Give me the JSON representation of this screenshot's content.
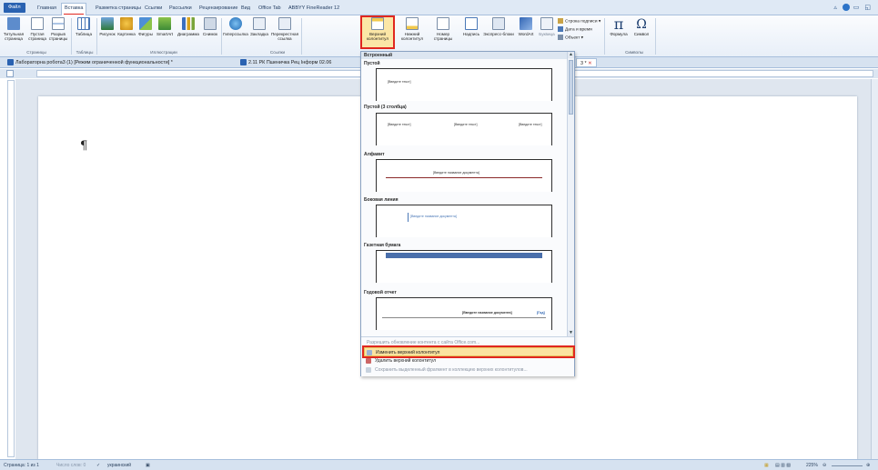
{
  "tabs": [
    "Файл",
    "Главная",
    "Вставка",
    "Разметка страницы",
    "Ссылки",
    "Рассылки",
    "Рецензирование",
    "Вид",
    "Office Tab",
    "ABBYY FineReader 12"
  ],
  "ribbon": {
    "buttons": {
      "title_page": "Титульная страница",
      "blank_page": "Пустая страница",
      "page_break": "Разрыв страницы",
      "table": "Таблица",
      "picture": "Рисунок",
      "clipart": "Картинка",
      "shapes": "Фигуры",
      "smartart": "SmartArt",
      "chart": "Диаграмма",
      "screenshot": "Снимок",
      "hyperlink": "Гиперссылка",
      "bookmark": "Закладка",
      "crossref": "Перекрестная ссылка",
      "header": "Верхний колонтитул",
      "footer": "Нижний колонтитул",
      "page_number": "Номер страницы",
      "textbox": "Надпись",
      "quickparts": "Экспресс-блоки",
      "wordart": "WordArt",
      "dropcap": "Буквица",
      "formula": "Формула",
      "symbol": "Символ"
    },
    "small": {
      "signature": "Строка подписи",
      "datetime": "Дата и время",
      "object": "Объект"
    },
    "groups": {
      "pages": "Страницы",
      "tables": "Таблицы",
      "illustrations": "Иллюстрации",
      "links": "Ссылки",
      "symbols": "Символы"
    }
  },
  "doc_tabs": {
    "doc1": "Лабораторна робота3 (1) [Режим ограниченной функциональности] *",
    "doc2": "2.11 РК Пшеничка Рец Інформ 02.06",
    "doc3": "3 *"
  },
  "dropdown": {
    "header": "Встроенный",
    "items": [
      {
        "title": "Пустой",
        "placeholders": [
          "[Введите текст]"
        ]
      },
      {
        "title": "Пустой (3 столбца)",
        "placeholders": [
          "[Введите текст]",
          "[Введите текст]",
          "[Введите текст]"
        ]
      },
      {
        "title": "Алфавит",
        "placeholders": [
          "[Введите название документа]"
        ]
      },
      {
        "title": "Боковая линия",
        "placeholders": [
          "[Введите название документа]"
        ]
      },
      {
        "title": "Газетная бумага",
        "placeholders": []
      },
      {
        "title": "Годовой отчет",
        "placeholders": [
          "[Введите название документа]",
          "[Год]"
        ]
      }
    ],
    "footer": {
      "update": "Разрешить обновление контента с сайта Office.com...",
      "edit": "Изменить верхний колонтитул",
      "remove": "Удалить верхний колонтитул",
      "save": "Сохранить выделенный фрагмент в коллекцию верхних колонтитулов..."
    }
  },
  "document": {
    "paragraph_mark": "¶"
  },
  "statusbar": {
    "page": "Страница: 1 из 1",
    "words": "Число слов: 0",
    "language": "украинский",
    "zoom": "225%"
  },
  "colors": {
    "accent": "#2a62b1",
    "highlight": "#e0271f",
    "hover": "#fbe3a0"
  }
}
